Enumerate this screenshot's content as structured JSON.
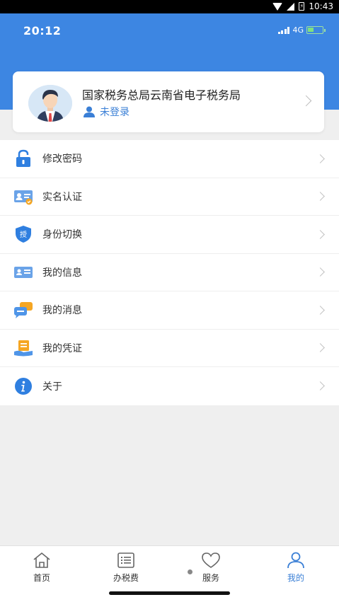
{
  "system_bar": {
    "time": "10:43"
  },
  "header": {
    "time": "20:12",
    "network": "4G"
  },
  "profile": {
    "org_name": "国家税务总局云南省电子税务局",
    "login_status": "未登录"
  },
  "menu": [
    {
      "label": "修改密码",
      "icon": "lock-icon"
    },
    {
      "label": "实名认证",
      "icon": "id-card-icon"
    },
    {
      "label": "身份切换",
      "icon": "shield-icon"
    },
    {
      "label": "我的信息",
      "icon": "info-card-icon"
    },
    {
      "label": "我的消息",
      "icon": "message-icon"
    },
    {
      "label": "我的凭证",
      "icon": "voucher-icon"
    },
    {
      "label": "关于",
      "icon": "about-icon"
    }
  ],
  "shield_glyph": "授",
  "tabs": [
    {
      "label": "首页",
      "icon": "home-icon"
    },
    {
      "label": "办税费",
      "icon": "list-icon"
    },
    {
      "label": "服务",
      "icon": "heart-icon"
    },
    {
      "label": "我的",
      "icon": "person-icon",
      "active": true
    }
  ],
  "colors": {
    "primary": "#3d86e2",
    "accent_text": "#3a7fd6"
  }
}
